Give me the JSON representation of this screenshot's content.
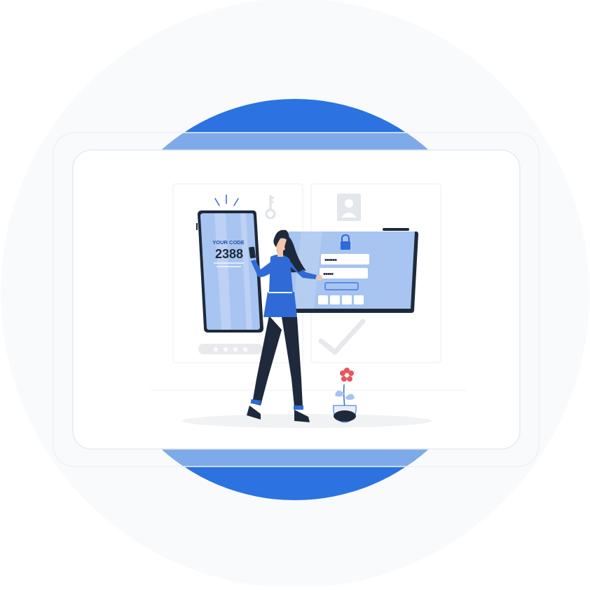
{
  "illustration": {
    "code_label": "YOUR CODE",
    "code_value": "2388",
    "password_mask_1": "••••••",
    "password_mask_2": "•••••",
    "rating_stars": "★ ★ ★ ★",
    "icons": {
      "key": "key-icon",
      "user": "user-icon",
      "lock": "lock-icon",
      "check": "check-icon",
      "flower": "flower-icon"
    }
  },
  "colors": {
    "outer_bg": "#f8fafc",
    "blue_dark": "#2c72e0",
    "blue_light": "#7eaae9",
    "phone_fill": "#a8c4f0",
    "ink": "#1e2a3b",
    "figure_blue": "#2f6ad6",
    "flower_red": "#e8555e"
  }
}
